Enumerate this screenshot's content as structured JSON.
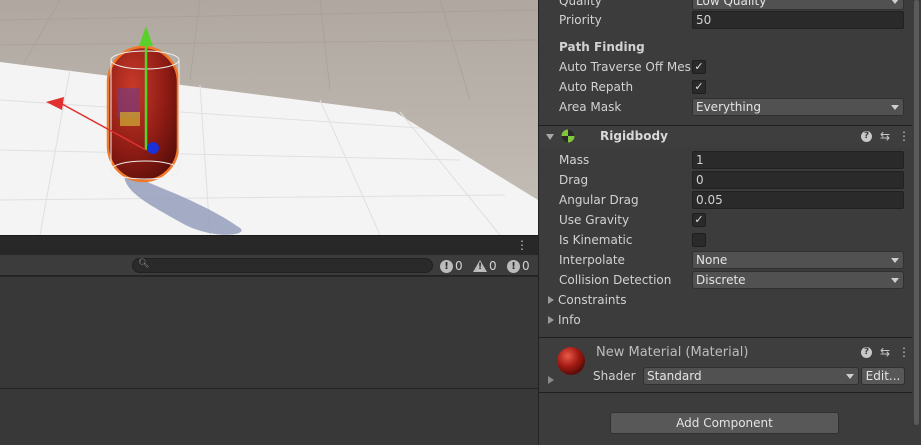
{
  "inspector": {
    "quality_label": "Quality",
    "quality_value": "Low Quality",
    "priority_label": "Priority",
    "priority_value": "50",
    "path_finding_title": "Path Finding",
    "auto_traverse_label": "Auto Traverse Off Mesh",
    "auto_traverse_checked": "✓",
    "auto_repath_label": "Auto Repath",
    "auto_repath_checked": "✓",
    "area_mask_label": "Area Mask",
    "area_mask_value": "Everything",
    "rigidbody": {
      "title": "Rigidbody",
      "mass_label": "Mass",
      "mass_value": "1",
      "drag_label": "Drag",
      "drag_value": "0",
      "angular_drag_label": "Angular Drag",
      "angular_drag_value": "0.05",
      "use_gravity_label": "Use Gravity",
      "use_gravity_checked": "✓",
      "is_kinematic_label": "Is Kinematic",
      "interpolate_label": "Interpolate",
      "interpolate_value": "None",
      "collision_detection_label": "Collision Detection",
      "collision_detection_value": "Discrete",
      "constraints_label": "Constraints",
      "info_label": "Info"
    },
    "material": {
      "title": "New Material (Material)",
      "shader_label": "Shader",
      "shader_value": "Standard",
      "edit_label": "Edit..."
    },
    "add_component_label": "Add Component"
  },
  "console": {
    "menu_glyph": "⋮",
    "info_count": "0",
    "warning_count": "0",
    "error_count": "0"
  },
  "colors": {
    "accent_orange": "#f07828",
    "capsule_red": "#a0221a"
  }
}
